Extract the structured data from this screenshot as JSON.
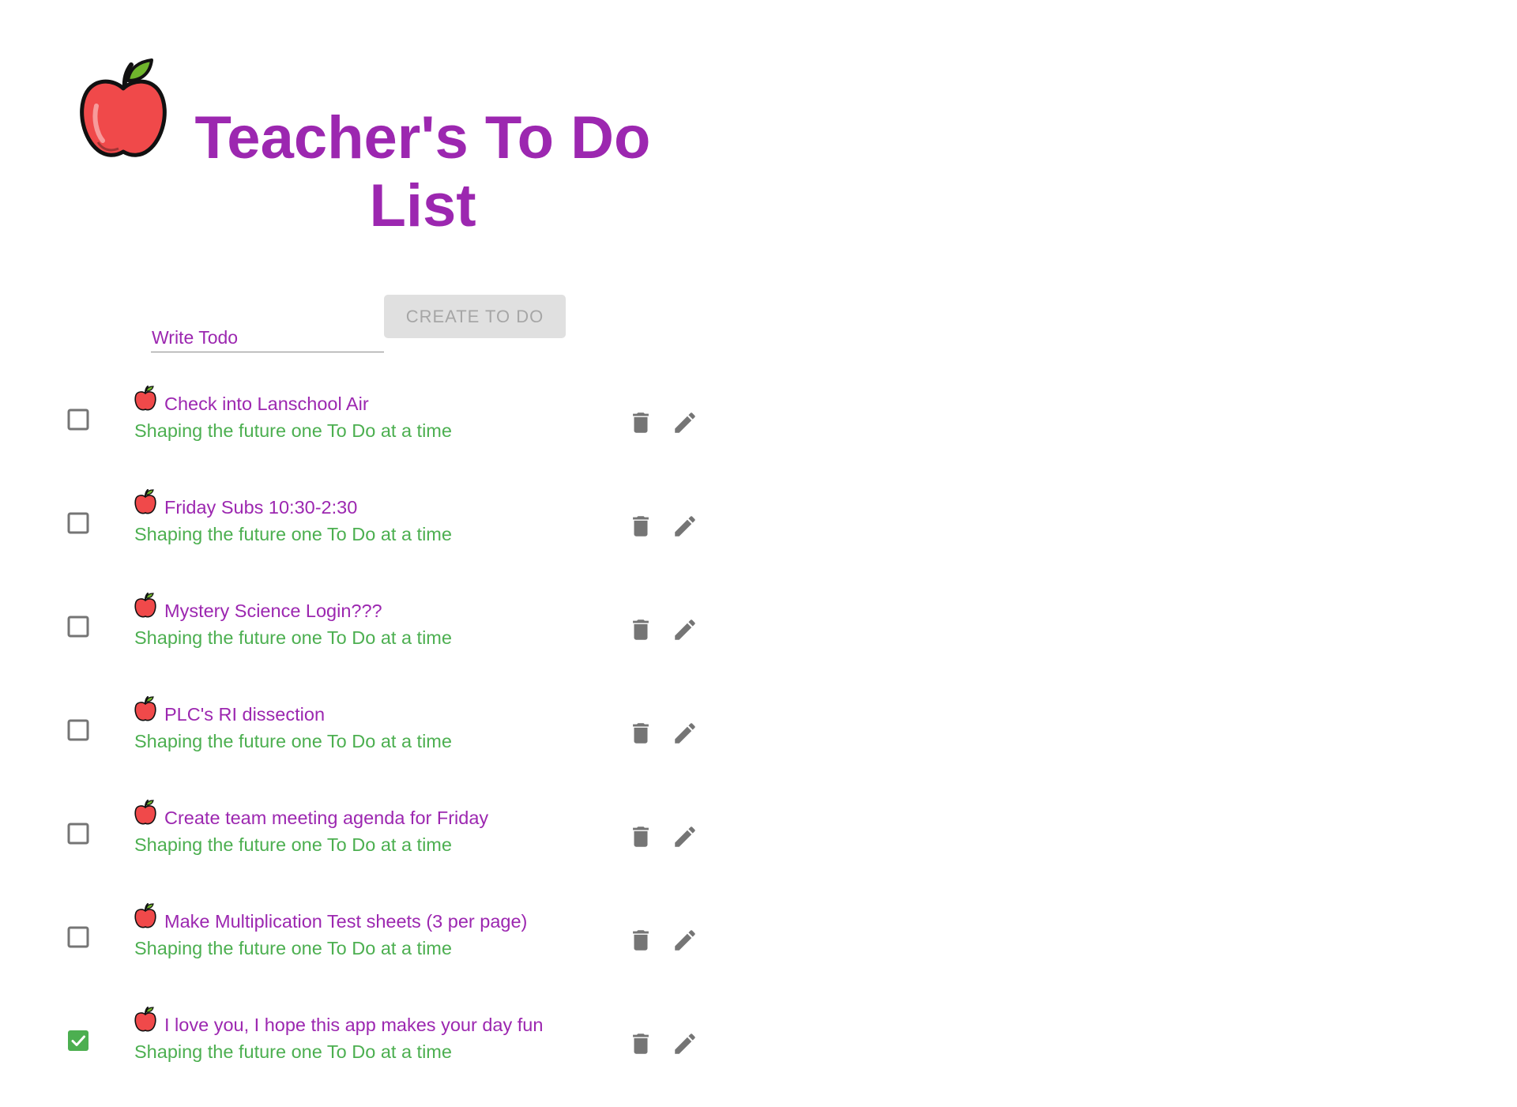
{
  "header": {
    "title": "Teacher's To Do List",
    "logo_icon": "apple-icon"
  },
  "form": {
    "input_placeholder": "Write Todo",
    "input_value": "",
    "create_button_label": "CREATE TO DO"
  },
  "colors": {
    "primary": "#9c27b0",
    "secondary": "#4caf50",
    "icon_gray": "#757575",
    "checked": "#4caf50"
  },
  "todos": [
    {
      "title": "Check into Lanschool Air",
      "subtitle": "Shaping the future one To Do at a time",
      "checked": false
    },
    {
      "title": "Friday Subs 10:30-2:30",
      "subtitle": "Shaping the future one To Do at a time",
      "checked": false
    },
    {
      "title": "Mystery Science Login???",
      "subtitle": "Shaping the future one To Do at a time",
      "checked": false
    },
    {
      "title": "PLC's RI dissection",
      "subtitle": "Shaping the future one To Do at a time",
      "checked": false
    },
    {
      "title": "Create team meeting agenda for Friday",
      "subtitle": "Shaping the future one To Do at a time",
      "checked": false
    },
    {
      "title": "Make Multiplication Test sheets (3 per page)",
      "subtitle": "Shaping the future one To Do at a time",
      "checked": false
    },
    {
      "title": "I love you, I hope this app makes your day fun",
      "subtitle": "Shaping the future one To Do at a time",
      "checked": true
    }
  ]
}
